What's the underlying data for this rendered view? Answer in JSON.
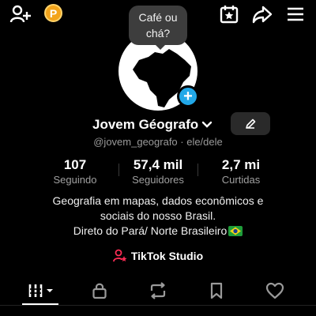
{
  "header": {
    "icons": [
      "add-friend-icon",
      "coin-icon",
      "calendar-star-icon",
      "share-icon",
      "menu-icon"
    ],
    "coin_symbol": "P"
  },
  "bubble": {
    "line1": "Café ou",
    "line2": "chá?"
  },
  "profile": {
    "name": "Jovem Géografo",
    "handle": "@jovem_geografo · ele/dele",
    "stats": [
      {
        "value": "107",
        "label": "Seguindo"
      },
      {
        "value": "57,4 mil",
        "label": "Seguidores"
      },
      {
        "value": "2,7 mi",
        "label": "Curtidas"
      }
    ],
    "bio": [
      "Geografia em mapas, dados econômicos e",
      "sociais do nosso Brasil.",
      "Direto do Pará/ Norte Brasileiro"
    ]
  },
  "studio": {
    "label": "TikTok Studio"
  },
  "tabs": [
    {
      "name": "videos",
      "icon": "grid-icon",
      "active": true
    },
    {
      "name": "private",
      "icon": "lock-icon",
      "active": false
    },
    {
      "name": "reposts",
      "icon": "repost-icon",
      "active": false
    },
    {
      "name": "favorites",
      "icon": "bookmark-icon",
      "active": false
    },
    {
      "name": "liked",
      "icon": "heart-icon",
      "active": false
    }
  ],
  "colors": {
    "background": "#000000",
    "accent_blue": "#22a8e8",
    "coin_orange": "#f3a41b",
    "studio_pink": "#fe2c55",
    "muted_text": "#9a9a9a"
  }
}
